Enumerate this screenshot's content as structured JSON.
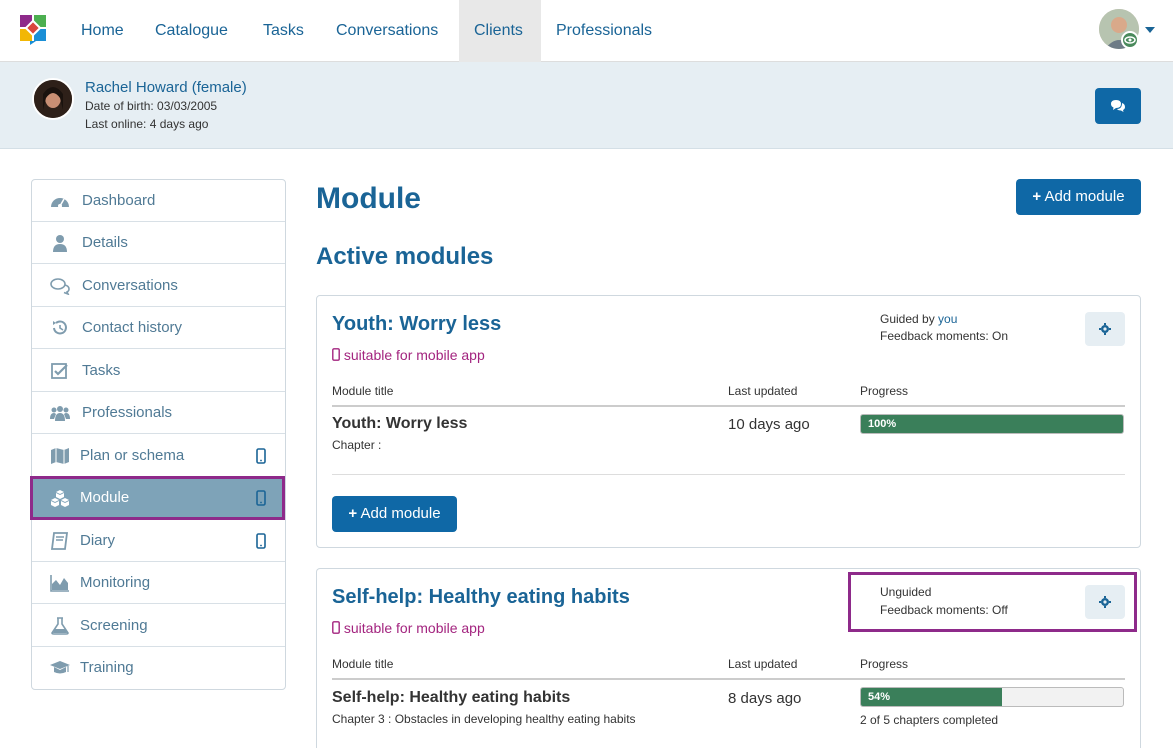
{
  "nav": {
    "items": [
      "Home",
      "Catalogue",
      "Tasks",
      "Conversations",
      "Clients",
      "Professionals"
    ],
    "active": "Clients"
  },
  "client": {
    "name": "Rachel Howard (female)",
    "dob": "Date of birth: 03/03/2005",
    "last_online": "Last online: 4 days ago"
  },
  "sidebar": {
    "items": [
      {
        "label": "Dashboard",
        "icon": "dashboard-icon"
      },
      {
        "label": "Details",
        "icon": "user-icon"
      },
      {
        "label": "Conversations",
        "icon": "comments-icon"
      },
      {
        "label": "Contact history",
        "icon": "history-icon"
      },
      {
        "label": "Tasks",
        "icon": "check-square-icon"
      },
      {
        "label": "Professionals",
        "icon": "users-icon"
      },
      {
        "label": "Plan or schema",
        "icon": "map-icon",
        "mobile": true
      },
      {
        "label": "Module",
        "icon": "cubes-icon",
        "mobile": true,
        "active": true
      },
      {
        "label": "Diary",
        "icon": "book-icon",
        "mobile": true
      },
      {
        "label": "Monitoring",
        "icon": "area-chart-icon"
      },
      {
        "label": "Screening",
        "icon": "flask-icon"
      },
      {
        "label": "Training",
        "icon": "graduation-cap-icon"
      }
    ]
  },
  "main": {
    "title": "Module",
    "add_button": "Add module",
    "active_title": "Active modules"
  },
  "columns": {
    "title": "Module title",
    "updated": "Last updated",
    "progress": "Progress"
  },
  "modules": [
    {
      "title": "Youth: Worry less",
      "mobile_note": "suitable for mobile app",
      "guide_prefix": "Guided by ",
      "guide_link": "you",
      "feedback": "Feedback moments: On",
      "row_title": "Youth: Worry less",
      "chapter": "Chapter :",
      "updated": "10 days ago",
      "progress": 100,
      "progress_label": "100%",
      "progress_note": "",
      "add_button": "Add module"
    },
    {
      "title": "Self-help: Healthy eating habits",
      "mobile_note": "suitable for mobile app",
      "guide_prefix": "Unguided",
      "guide_link": "",
      "feedback": "Feedback moments: Off",
      "row_title": "Self-help: Healthy eating habits",
      "chapter": "Chapter 3 : Obstacles in developing healthy eating habits",
      "updated": "8 days ago",
      "progress": 54,
      "progress_label": "54%",
      "progress_note": "2 of 5 chapters completed"
    }
  ],
  "colors": {
    "brand": "#0f68a6",
    "highlight": "#8e2a8a",
    "progress": "#3a7f5a",
    "mobile_note": "#a3247f"
  }
}
